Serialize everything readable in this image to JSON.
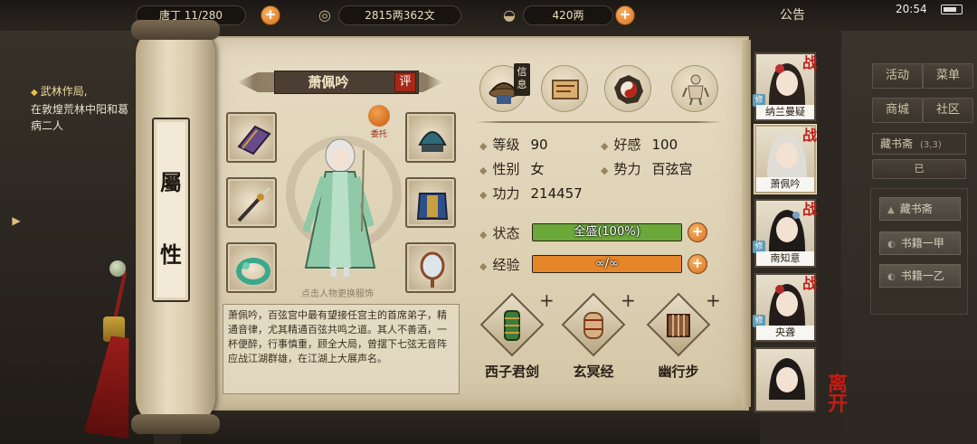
{
  "topbar": {
    "population": "唐丁 11/280",
    "copper": "2815两362文",
    "silver": "420两",
    "notice": "公告",
    "clock": "20:54"
  },
  "quest": {
    "title": "武林作局,",
    "desc": "在敦煌荒林中阳和葛病二人"
  },
  "right_menu": {
    "activity": "活动",
    "menu": "菜单",
    "shop": "商城",
    "community": "社区",
    "location": "藏书斋",
    "location_coord": "(3,3)",
    "location_sub": "已",
    "items": [
      "藏书斋",
      "书籍一甲",
      "书籍一乙"
    ]
  },
  "scroll": {
    "title_char_1": "屬",
    "title_char_2": "性"
  },
  "character": {
    "name": "萧佩吟",
    "eval": "评",
    "commission": "委托",
    "figure_hint": "点击人物更换服饰",
    "bio": "萧佩吟，百弦宫中最有望接任宫主的首席弟子，精通音律，尤其精通百弦共鸣之道。其人不善酒，一杯便醉，行事慎重，顾全大局，曾摆下七弦无音阵应战江湖群雄，在江湖上大展声名。"
  },
  "tabs": {
    "active_label": "信息",
    "items": [
      "info-hat-icon",
      "scroll-map-icon",
      "bagua-icon",
      "meridian-figure-icon"
    ]
  },
  "stats": {
    "level_label": "等级",
    "level": "90",
    "favor_label": "好感",
    "favor": "100",
    "gender_label": "性别",
    "gender": "女",
    "faction_label": "势力",
    "faction": "百弦宫",
    "power_label": "功力",
    "power": "214457"
  },
  "bars": {
    "status_label": "状态",
    "status_text": "全盛(100%)",
    "status_fill": 1.0,
    "status_color": "#6aa83a",
    "exp_label": "经验",
    "exp_text": "∞/∞",
    "exp_fill": 1.0,
    "exp_color": "#e6862a"
  },
  "skills": [
    {
      "name": "西子君剑",
      "icon": "bamboo-scroll-icon"
    },
    {
      "name": "玄冥经",
      "icon": "rolled-scroll-icon"
    },
    {
      "name": "幽行步",
      "icon": "bamboo-slips-icon"
    }
  ],
  "roster": [
    {
      "name": "纳兰曼疑",
      "battle": "战",
      "cultivate": "修"
    },
    {
      "name": "萧佩吟",
      "battle": "战"
    },
    {
      "name": "南知意",
      "battle": "战",
      "cultivate": "修"
    },
    {
      "name": "央聋",
      "battle": "战",
      "cultivate": "修"
    },
    {
      "name": ""
    }
  ],
  "leave": "离开"
}
